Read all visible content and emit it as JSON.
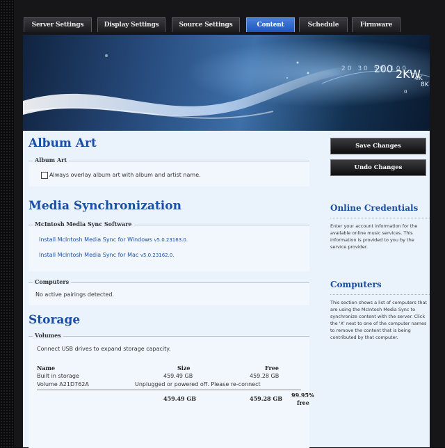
{
  "tabs": [
    {
      "label": "Server Settings",
      "active": false
    },
    {
      "label": "Display Settings",
      "active": false
    },
    {
      "label": "Source Settings",
      "active": false
    },
    {
      "label": "Content",
      "active": true
    },
    {
      "label": "Schedule",
      "active": false
    },
    {
      "label": "Firmware",
      "active": false
    }
  ],
  "banner": {
    "dial_labels": [
      "20",
      "30",
      "50",
      "100",
      "200"
    ],
    "big_label": "2KW",
    "sub_labels": [
      "4K",
      "8K"
    ],
    "scale_label": "0"
  },
  "album_art": {
    "heading": "Album Art",
    "legend": "Album Art",
    "checkbox_label": "Always overlay album art with album and artist name.",
    "checked": false
  },
  "media_sync": {
    "heading": "Media Synchronization",
    "legend": "McIntosh Media Sync Software",
    "windows_link": "Install McIntosh Media Sync for Windows",
    "windows_version": "v5.0.23163.0.",
    "mac_link": "Install McIntosh Media Sync for Mac",
    "mac_version": "v5.0.23162.0."
  },
  "computers_box": {
    "legend": "Computers",
    "status": "No active pairings detected."
  },
  "storage": {
    "heading": "Storage",
    "legend": "Volumes",
    "note": "Connect USB drives to expand storage capacity.",
    "col_name": "Name",
    "col_size": "Size",
    "col_free": "Free",
    "rows": [
      {
        "name": "Built in storage",
        "size": "459.49 GB",
        "free": "459.28 GB"
      },
      {
        "name": "Volume A21D762A",
        "status": "Unplugged or powered off. Please re-connect"
      }
    ],
    "total_size": "459.49 GB",
    "total_free": "459.28 GB",
    "total_pct": "99.95%",
    "total_pct_label": "free"
  },
  "actions": {
    "save": "Save Changes",
    "undo": "Undo Changes"
  },
  "online_credentials": {
    "heading": "Online Credentials",
    "body": "Enter your account information for the available online music services. This information is provided to you by the service provider."
  },
  "computers_side": {
    "heading": "Computers",
    "body": "This section shows a list of computers that are using the McIntosh Media Sync to synchronize content with the server. Click the 'X' next to one of the computer names to remove the content that is being contributed by that computer."
  },
  "colors": {
    "accent_blue": "#1a4fa3",
    "active_tab": "#2a63c8",
    "page_bg": "#eaf2fc"
  }
}
